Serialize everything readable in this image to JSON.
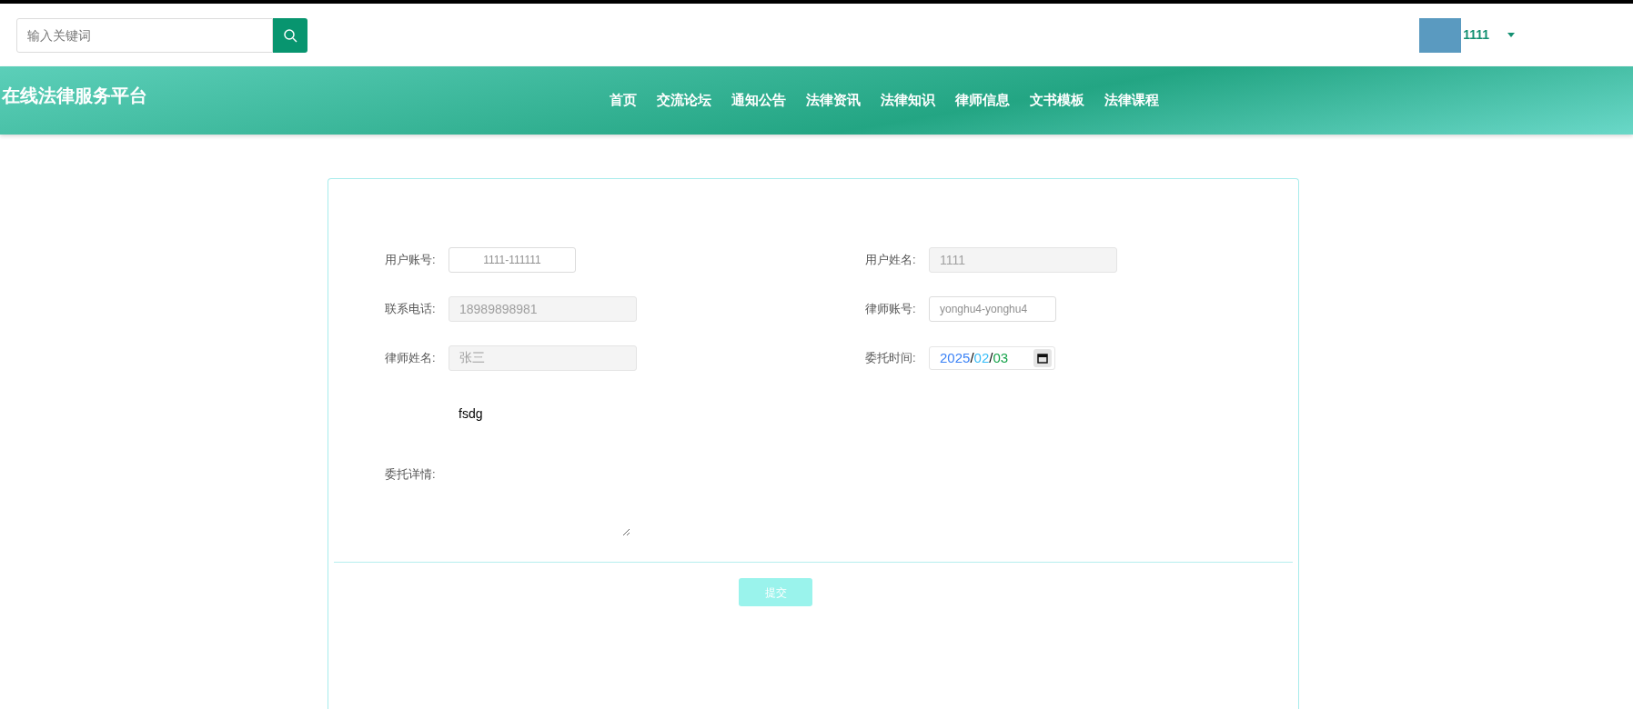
{
  "search": {
    "placeholder": "输入关键词"
  },
  "user": {
    "name": "1111"
  },
  "site_title": "在线法律服务平台",
  "nav": [
    "首页",
    "交流论坛",
    "通知公告",
    "法律资讯",
    "法律知识",
    "律师信息",
    "文书模板",
    "法律课程"
  ],
  "form": {
    "fields": [
      {
        "label": "用户账号:",
        "value": "1111-111111",
        "kind": "account",
        "disabled": false
      },
      {
        "label": "用户姓名:",
        "value": "1111",
        "kind": "long",
        "disabled": true
      },
      {
        "label": "联系电话:",
        "value": "18989898981",
        "kind": "long",
        "disabled": true
      },
      {
        "label": "律师账号:",
        "value": "yonghu4-yonghu4",
        "kind": "short",
        "disabled": false
      },
      {
        "label": "律师姓名:",
        "value": "张三",
        "kind": "long",
        "disabled": true
      },
      {
        "label": "委托时间:",
        "value": "2025/02/03",
        "kind": "date"
      }
    ],
    "details": {
      "label": "委托详情:",
      "value": "fsdg"
    },
    "submit": "提交"
  }
}
